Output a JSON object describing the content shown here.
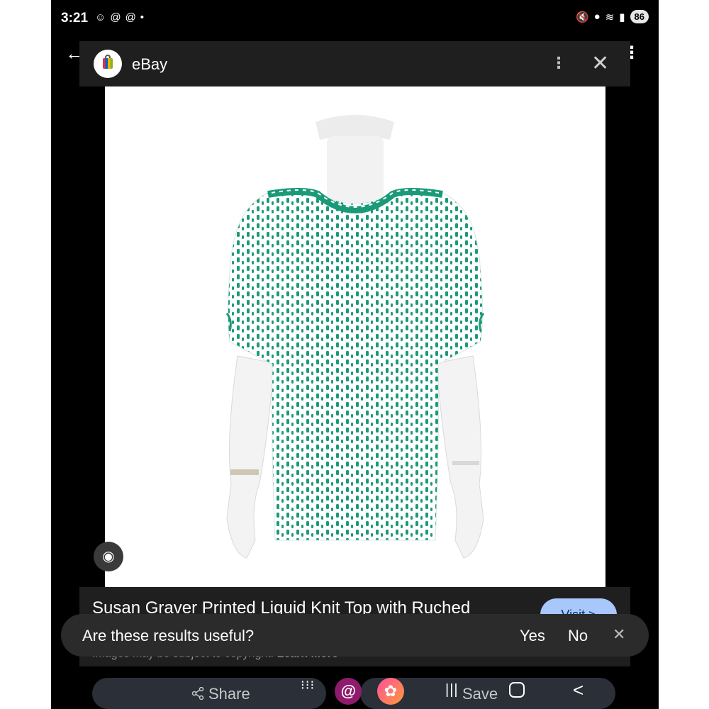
{
  "status_bar": {
    "time": "3:21",
    "battery": "86",
    "notification_icons": [
      "message-icon",
      "threads-icon",
      "threads-icon",
      "dot-icon"
    ],
    "system_icons": [
      "mute-icon",
      "location-icon",
      "wifi-icon",
      "signal-icon"
    ]
  },
  "sheet": {
    "app_name": "eBay",
    "menu_icon": "⋮",
    "close_icon": "✕",
    "back_icon": "←",
    "outer_menu_icon": "⋮"
  },
  "product": {
    "title": "Susan Graver Printed Liquid Knit Top with Ruched",
    "visit_label": "Visit >",
    "copyright_text": "Images may be subject to copyright.",
    "learn_more": "Learn More",
    "pattern_color": "#1a9a78"
  },
  "feedback": {
    "question": "Are these results useful?",
    "yes": "Yes",
    "no": "No",
    "dismiss": "✕"
  },
  "actions": {
    "share": "Share",
    "save": "Save"
  },
  "nav": {
    "apps_icon": "⋮⋮⋮",
    "recents_icon": "|||",
    "back_icon": "<"
  }
}
